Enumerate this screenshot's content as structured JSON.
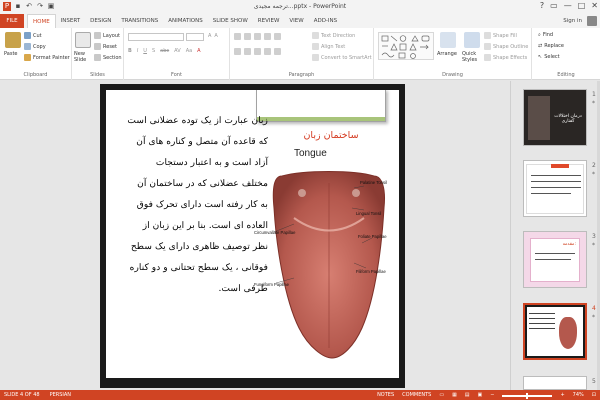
{
  "window": {
    "title": "ترجمه مجیدی...pptx - PowerPoint",
    "controls": [
      "?",
      "▭",
      "—",
      "□",
      "✕"
    ]
  },
  "tabs": {
    "file": "FILE",
    "items": [
      "HOME",
      "INSERT",
      "DESIGN",
      "TRANSITIONS",
      "ANIMATIONS",
      "SLIDE SHOW",
      "REVIEW",
      "VIEW",
      "ADD-INS"
    ],
    "active": "HOME",
    "signin": "Sign in"
  },
  "ribbon": {
    "clipboard": {
      "label": "Clipboard",
      "paste": "Paste",
      "cut": "Cut",
      "copy": "Copy",
      "format_painter": "Format Painter"
    },
    "slides": {
      "label": "Slides",
      "new_slide": "New Slide",
      "layout": "Layout",
      "reset": "Reset",
      "section": "Section"
    },
    "font": {
      "label": "Font",
      "font_name": "",
      "font_size": "",
      "buttons": [
        "B",
        "I",
        "U",
        "S",
        "abc",
        "AV",
        "Aa",
        "A"
      ]
    },
    "paragraph": {
      "label": "Paragraph",
      "text_direction": "Text Direction",
      "align_text": "Align Text",
      "convert_smartart": "Convert to SmartArt"
    },
    "drawing": {
      "label": "Drawing",
      "arrange": "Arrange",
      "quick_styles": "Quick Styles",
      "shape_fill": "Shape Fill",
      "shape_outline": "Shape Outline",
      "shape_effects": "Shape Effects"
    },
    "editing": {
      "label": "Editing",
      "find": "Find",
      "replace": "Replace",
      "select": "Select"
    }
  },
  "slide": {
    "title": "ساختمان زبان",
    "body_lines": [
      "زبان عبارت از یک توده عضلانی است",
      "که قاعده آن متصل و کناره های آن",
      "آزاد است و به اعتبار دستجات",
      "مختلف عضلانی که در ساختمان آن",
      "به کار رفته است دارای تحرک فوق",
      "العاده ای است. بنا بر این زبان از",
      "نظر توصیف ظاهری دارای یک سطح",
      "فوقانی ، یک سطح تحتانی و دو کناره",
      "طرفی است."
    ],
    "figure": {
      "heading": "Tongue",
      "labels": {
        "palatine": "Palatine Tonsil",
        "lingual": "Lingual Tonsil",
        "circumvallate": "Circumvallate Papillae",
        "foliate": "Foliate Papillae",
        "fungiform": "Fungiform Papillae",
        "filiform": "Filiform Papillae"
      }
    }
  },
  "thumbnails": [
    {
      "num": "1",
      "star": "*",
      "caption": "درمان اختلالات گفتاری"
    },
    {
      "num": "2",
      "star": "*",
      "caption": ""
    },
    {
      "num": "3",
      "star": "*",
      "caption": "مقدمه:"
    },
    {
      "num": "4",
      "star": "*",
      "caption": ""
    },
    {
      "num": "5",
      "star": "",
      "caption": ""
    }
  ],
  "status": {
    "slide": "SLIDE 4 OF 48",
    "language": "PERSIAN",
    "notes": "NOTES",
    "comments": "COMMENTS",
    "zoom": "74%"
  },
  "colors": {
    "accent": "#d04423",
    "slide_title": "#d4381e"
  }
}
